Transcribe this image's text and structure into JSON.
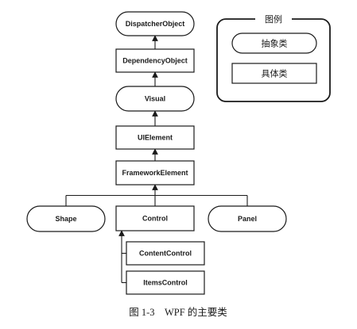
{
  "diagram": {
    "nodes": [
      {
        "id": "dispatcher",
        "label": "DispatcherObject",
        "kind": "abstract"
      },
      {
        "id": "dependency",
        "label": "DependencyObject",
        "kind": "concrete"
      },
      {
        "id": "visual",
        "label": "Visual",
        "kind": "abstract"
      },
      {
        "id": "uielement",
        "label": "UIElement",
        "kind": "concrete"
      },
      {
        "id": "framework",
        "label": "FrameworkElement",
        "kind": "concrete"
      },
      {
        "id": "shape",
        "label": "Shape",
        "kind": "abstract"
      },
      {
        "id": "control",
        "label": "Control",
        "kind": "concrete"
      },
      {
        "id": "panel",
        "label": "Panel",
        "kind": "abstract"
      },
      {
        "id": "contentcontrol",
        "label": "ContentControl",
        "kind": "concrete"
      },
      {
        "id": "itemscontrol",
        "label": "ItemsControl",
        "kind": "concrete"
      }
    ],
    "edges": [
      {
        "from": "dependency",
        "to": "dispatcher"
      },
      {
        "from": "visual",
        "to": "dependency"
      },
      {
        "from": "uielement",
        "to": "visual"
      },
      {
        "from": "framework",
        "to": "uielement"
      },
      {
        "from": "shape",
        "to": "framework"
      },
      {
        "from": "control",
        "to": "framework"
      },
      {
        "from": "panel",
        "to": "framework"
      },
      {
        "from": "contentcontrol",
        "to": "control"
      },
      {
        "from": "itemscontrol",
        "to": "control"
      }
    ]
  },
  "legend": {
    "title": "图例",
    "abstract_label": "抽象类",
    "concrete_label": "具体类"
  },
  "caption": "图 1-3    WPF 的主要类"
}
